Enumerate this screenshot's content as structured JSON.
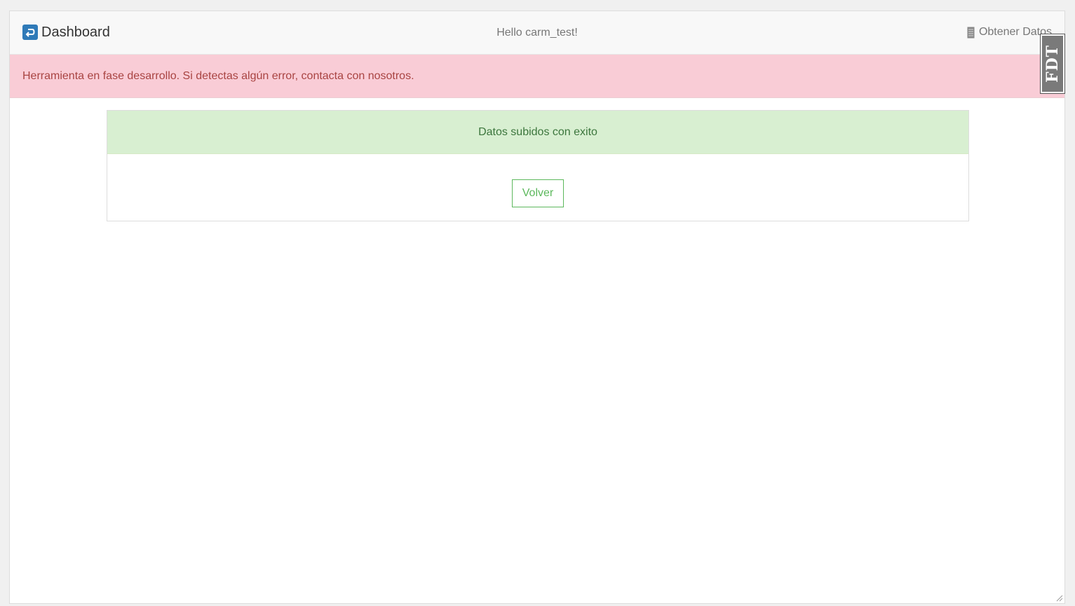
{
  "navbar": {
    "brand_label": "Dashboard",
    "brand_icon": "return-arrow-icon",
    "greeting": "Hello carm_test!",
    "obtener_label": "Obtener Datos",
    "obtener_icon": "server-icon"
  },
  "alert": {
    "message": "Herramienta en fase desarrollo. Si detectas algún error, contacta con nosotros.",
    "color": "#a94442",
    "background": "#f9ccd6"
  },
  "panel": {
    "heading": "Datos subidos con exito",
    "heading_color": "#3c763d",
    "heading_background": "#d8efd1",
    "button_label": "Volver",
    "button_color": "#5cb85c"
  },
  "badge": {
    "label": "FDT"
  }
}
